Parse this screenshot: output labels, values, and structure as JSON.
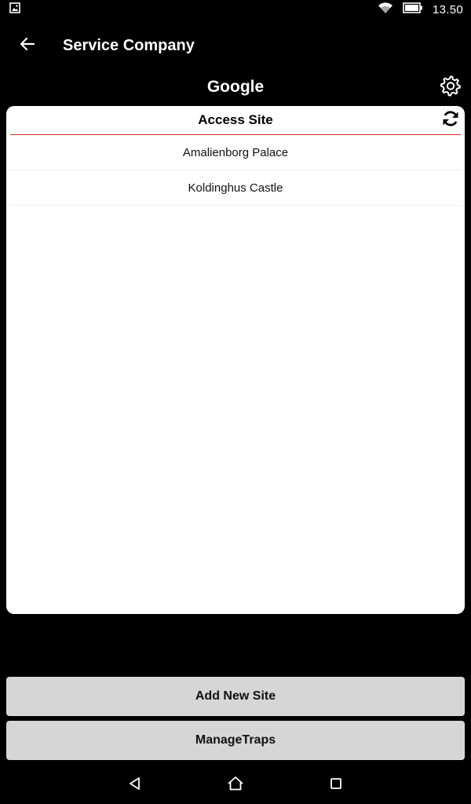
{
  "status_bar": {
    "time": "13.50",
    "icons": [
      "image-notification-icon",
      "wifi-icon",
      "battery-icon"
    ]
  },
  "app_bar": {
    "title": "Service Company",
    "back_icon": "arrow-left-icon"
  },
  "company": {
    "name": "Google",
    "settings_icon": "gear-icon"
  },
  "card": {
    "title": "Access Site",
    "refresh_icon": "refresh-icon",
    "divider_color": "#d32f2f",
    "sites": [
      {
        "label": "Amalienborg Palace"
      },
      {
        "label": "Koldinghus Castle"
      }
    ]
  },
  "actions": {
    "add_new_site": "Add New Site",
    "manage_traps": "ManageTraps"
  },
  "nav_bar": {
    "icons": [
      "back-triangle-icon",
      "home-icon",
      "recents-square-icon"
    ]
  },
  "colors": {
    "background": "#000000",
    "card": "#ffffff",
    "button": "#d6d6d6",
    "accent": "#d32f2f"
  }
}
